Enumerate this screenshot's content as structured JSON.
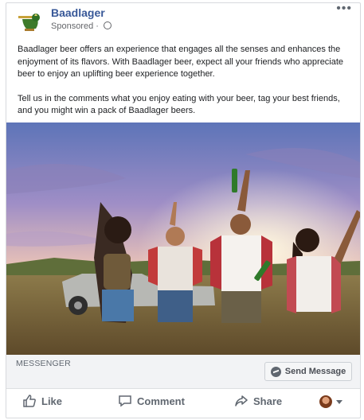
{
  "post": {
    "page_name": "Baadlager",
    "sponsored_label": "Sponsored · ",
    "more_label": "•••",
    "body_paragraph_1": "Baadlager beer offers an experience that engages all the senses and enhances the enjoyment of its flavors. With Baadlager beer, expect all your friends who appreciate beer to enjoy an uplifting beer experience together.",
    "body_paragraph_2": "Tell us in the comments what you enjoy eating with your beer, tag your best friends, and you might win a pack of Baadlager beers.",
    "image_description": "Group of friends celebrating with beer bottles outdoors at sunset"
  },
  "messenger": {
    "label": "MESSENGER",
    "button_label": "Send Message"
  },
  "actions": {
    "like_label": "Like",
    "comment_label": "Comment",
    "share_label": "Share"
  },
  "icons": {
    "globe": "globe-icon",
    "messenger": "messenger-icon",
    "like": "thumbs-up-icon",
    "comment": "speech-bubble-icon",
    "share": "share-arrow-icon"
  },
  "colors": {
    "brand": "#385898",
    "muted": "#606770",
    "bar_bg": "#f2f3f5"
  }
}
